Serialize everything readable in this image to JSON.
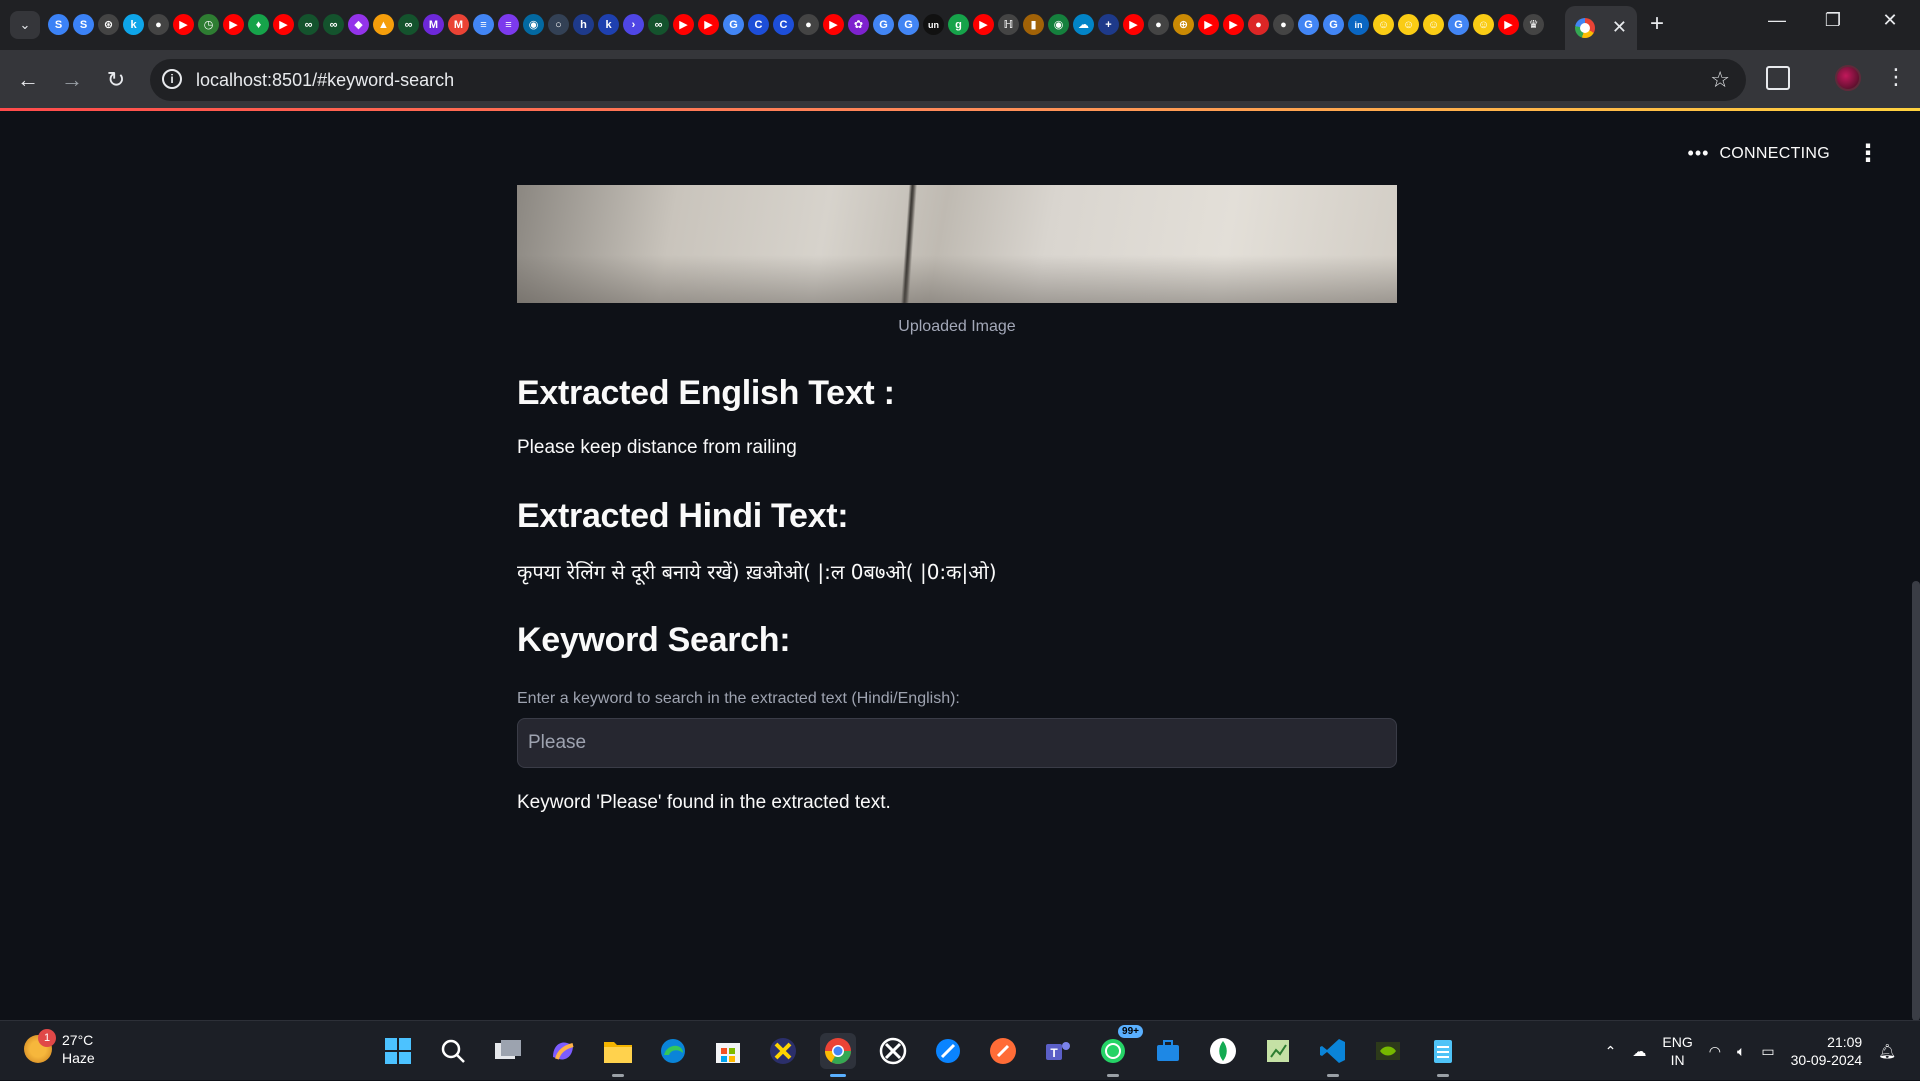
{
  "browser": {
    "url": "localhost:8501/#keyword-search",
    "pinned_tabs": [
      {
        "icon": "s-icon",
        "glyph": "S",
        "color": "#3b82f6"
      },
      {
        "icon": "s-icon",
        "glyph": "S",
        "color": "#3b82f6"
      },
      {
        "icon": "openai-icon",
        "glyph": "⊛",
        "color": "#444"
      },
      {
        "icon": "k-icon",
        "glyph": "k",
        "color": "#0ea5e9"
      },
      {
        "icon": "github-icon",
        "glyph": "●",
        "color": "#444"
      },
      {
        "icon": "youtube-icon",
        "glyph": "▶",
        "color": "#ff0000"
      },
      {
        "icon": "clock-icon",
        "glyph": "◷",
        "color": "#2e7d32"
      },
      {
        "icon": "youtube-icon",
        "glyph": "▶",
        "color": "#ff0000"
      },
      {
        "icon": "leaf-icon",
        "glyph": "♦",
        "color": "#16a34a"
      },
      {
        "icon": "youtube-icon",
        "glyph": "▶",
        "color": "#ff0000"
      },
      {
        "icon": "infinity-icon",
        "glyph": "∞",
        "color": "#14532d"
      },
      {
        "icon": "infinity-icon",
        "glyph": "∞",
        "color": "#14532d"
      },
      {
        "icon": "purple-icon",
        "glyph": "◆",
        "color": "#9333ea"
      },
      {
        "icon": "drive-icon",
        "glyph": "▲",
        "color": "#f59e0b"
      },
      {
        "icon": "infinity-icon",
        "glyph": "∞",
        "color": "#14532d"
      },
      {
        "icon": "m-icon",
        "glyph": "M",
        "color": "#6d28d9"
      },
      {
        "icon": "gmail-icon",
        "glyph": "M",
        "color": "#ea4335"
      },
      {
        "icon": "docs-icon",
        "glyph": "≡",
        "color": "#4285f4"
      },
      {
        "icon": "forms-icon",
        "glyph": "≡",
        "color": "#7c3aed"
      },
      {
        "icon": "circle-icon",
        "glyph": "◉",
        "color": "#0369a1"
      },
      {
        "icon": "circle-icon",
        "glyph": "○",
        "color": "#334155"
      },
      {
        "icon": "h-icon",
        "glyph": "h",
        "color": "#1e3a8a"
      },
      {
        "icon": "k-icon",
        "glyph": "k",
        "color": "#1e40af"
      },
      {
        "icon": "terminal-icon",
        "glyph": "›",
        "color": "#4f46e5"
      },
      {
        "icon": "infinity-icon",
        "glyph": "∞",
        "color": "#14532d"
      },
      {
        "icon": "youtube-icon",
        "glyph": "▶",
        "color": "#ff0000"
      },
      {
        "icon": "youtube-icon",
        "glyph": "▶",
        "color": "#ff0000"
      },
      {
        "icon": "google-icon",
        "glyph": "G",
        "color": "#4285f4"
      },
      {
        "icon": "c-icon",
        "glyph": "C",
        "color": "#1d4ed8"
      },
      {
        "icon": "c-icon",
        "glyph": "C",
        "color": "#1d4ed8"
      },
      {
        "icon": "github-icon",
        "glyph": "●",
        "color": "#444"
      },
      {
        "icon": "youtube-icon",
        "glyph": "▶",
        "color": "#ff0000"
      },
      {
        "icon": "paw-icon",
        "glyph": "✿",
        "color": "#7e22ce"
      },
      {
        "icon": "google-icon",
        "glyph": "G",
        "color": "#4285f4"
      },
      {
        "icon": "google-icon",
        "glyph": "G",
        "color": "#4285f4"
      },
      {
        "icon": "un-icon",
        "glyph": "un",
        "color": "#111"
      },
      {
        "icon": "g-icon",
        "glyph": "g",
        "color": "#16a34a"
      },
      {
        "icon": "youtube-icon",
        "glyph": "▶",
        "color": "#ff0000"
      },
      {
        "icon": "h-icon",
        "glyph": "ℍ",
        "color": "#444"
      },
      {
        "icon": "chart-icon",
        "glyph": "▮",
        "color": "#a16207"
      },
      {
        "icon": "green-icon",
        "glyph": "◉",
        "color": "#15803d"
      },
      {
        "icon": "cloud-icon",
        "glyph": "☁",
        "color": "#0284c7"
      },
      {
        "icon": "plus-icon",
        "glyph": "+",
        "color": "#1e3a8a"
      },
      {
        "icon": "youtube-icon",
        "glyph": "▶",
        "color": "#ff0000"
      },
      {
        "icon": "github-icon",
        "glyph": "●",
        "color": "#444"
      },
      {
        "icon": "globe-icon",
        "glyph": "⊕",
        "color": "#ca8a04"
      },
      {
        "icon": "youtube-icon",
        "glyph": "▶",
        "color": "#ff0000"
      },
      {
        "icon": "youtube-icon",
        "glyph": "▶",
        "color": "#ff0000"
      },
      {
        "icon": "red-icon",
        "glyph": "●",
        "color": "#dc2626"
      },
      {
        "icon": "github-icon",
        "glyph": "●",
        "color": "#444"
      },
      {
        "icon": "google-icon",
        "glyph": "G",
        "color": "#4285f4"
      },
      {
        "icon": "google-icon",
        "glyph": "G",
        "color": "#4285f4"
      },
      {
        "icon": "linkedin-icon",
        "glyph": "in",
        "color": "#0a66c2"
      },
      {
        "icon": "hugging-face-icon",
        "glyph": "☺",
        "color": "#facc15"
      },
      {
        "icon": "hugging-face-icon",
        "glyph": "☺",
        "color": "#facc15"
      },
      {
        "icon": "hugging-face-icon",
        "glyph": "☺",
        "color": "#facc15"
      },
      {
        "icon": "google-icon",
        "glyph": "G",
        "color": "#4285f4"
      },
      {
        "icon": "hugging-face-icon",
        "glyph": "☺",
        "color": "#facc15"
      },
      {
        "icon": "youtube-icon",
        "glyph": "▶",
        "color": "#ff0000"
      },
      {
        "icon": "crown-icon",
        "glyph": "♛",
        "color": "#444"
      }
    ]
  },
  "app": {
    "status": "CONNECTING",
    "image_caption": "Uploaded Image",
    "english_heading": "Extracted English Text :",
    "english_text": "Please keep distance from railing",
    "hindi_heading": "Extracted Hindi Text:",
    "hindi_text": "कृपया रेलिंग से दूरी बनाये रखें) ख़ओओ( |:ल 0ब७ओ( |0:क|ओ)",
    "keyword_heading": "Keyword Search:",
    "keyword_label": "Enter a keyword to search in the extracted text (Hindi/English):",
    "keyword_value": "Please",
    "result_text": "Keyword 'Please' found in the extracted text."
  },
  "taskbar": {
    "weather_temp": "27°C",
    "weather_desc": "Haze",
    "weather_badge": "1",
    "whatsapp_count": "99+",
    "lang_top": "ENG",
    "lang_bottom": "IN",
    "time": "21:09",
    "date": "30-09-2024"
  }
}
